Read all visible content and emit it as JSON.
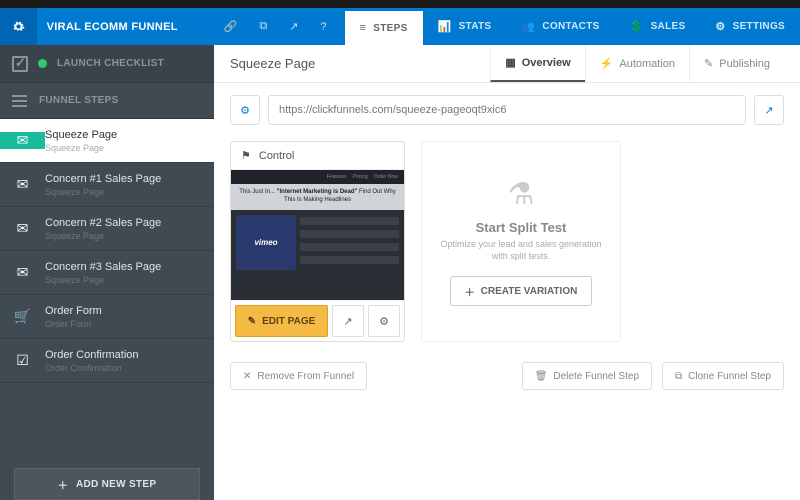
{
  "header": {
    "title": "VIRAL ECOMM FUNNEL",
    "tabs": [
      {
        "icon": "≡",
        "label": "STEPS"
      },
      {
        "icon": "⫾",
        "label": "STATS"
      },
      {
        "icon": "👥",
        "label": "CONTACTS"
      },
      {
        "icon": "⊡",
        "label": "SALES"
      },
      {
        "icon": "⚙",
        "label": "SETTINGS"
      }
    ]
  },
  "sidebar": {
    "launch": "LAUNCH CHECKLIST",
    "steps_header": "FUNNEL STEPS",
    "steps": [
      {
        "icon": "✉",
        "label": "Squeeze Page",
        "sub": "Squeeze Page",
        "active": true
      },
      {
        "icon": "✉",
        "label": "Concern #1 Sales Page",
        "sub": "Squeeze Page"
      },
      {
        "icon": "✉",
        "label": "Concern #2 Sales Page",
        "sub": "Squeeze Page"
      },
      {
        "icon": "✉",
        "label": "Concern #3 Sales Page",
        "sub": "Squeeze Page"
      },
      {
        "icon": "🛒",
        "label": "Order Form",
        "sub": "Order Form"
      },
      {
        "icon": "☑",
        "label": "Order Confirmation",
        "sub": "Order Confirmation"
      }
    ],
    "add_step": "ADD NEW STEP"
  },
  "main": {
    "title": "Squeeze Page",
    "subtabs": [
      {
        "icon": "▦",
        "label": "Overview",
        "active": true
      },
      {
        "icon": "⚡",
        "label": "Automation"
      },
      {
        "icon": "✎",
        "label": "Publishing"
      }
    ],
    "url": "https://clickfunnels.com/squeeze-pageoqt9xic6",
    "control": {
      "label": "Control",
      "edit": "EDIT PAGE",
      "headline1": "This Just In...",
      "headline2": "\"Internet Marketing is Dead\"",
      "headline3": "Find Out Why This Is Making Headlines",
      "video": "vimeo"
    },
    "split": {
      "title": "Start Split Test",
      "desc": "Optimize your lead and sales generation with split tests.",
      "button": "CREATE VARIATION"
    },
    "footer": {
      "remove": "Remove From Funnel",
      "delete": "Delete Funnel Step",
      "clone": "Clone Funnel Step"
    }
  }
}
